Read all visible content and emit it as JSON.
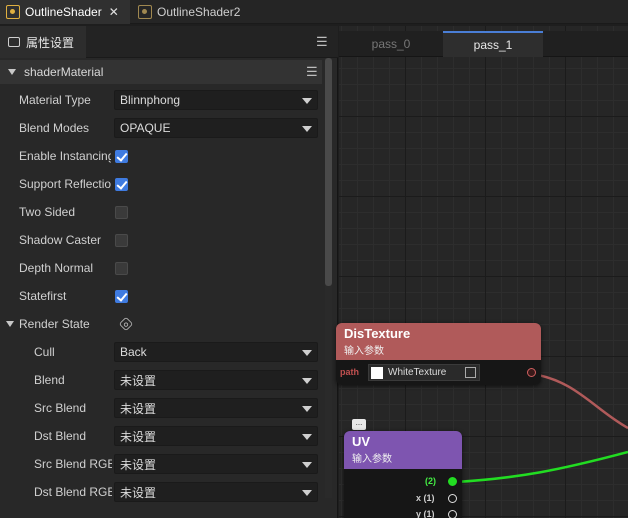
{
  "file_tabs": [
    {
      "label": "OutlineShader",
      "close": "✕"
    },
    {
      "label": "OutlineShader2"
    }
  ],
  "panel": {
    "tab_label": "属性设置",
    "menu_glyph": "☰",
    "section_title": "shaderMaterial",
    "rows": {
      "material_type": {
        "label": "Material Type",
        "value": "Blinnphong"
      },
      "blend_modes": {
        "label": "Blend Modes",
        "value": "OPAQUE"
      },
      "enable_instancing": {
        "label": "Enable Instancing",
        "checked": true
      },
      "support_reflection": {
        "label": "Support Reflection",
        "checked": true
      },
      "two_sided": {
        "label": "Two Sided",
        "checked": false
      },
      "shadow_caster": {
        "label": "Shadow Caster",
        "checked": false
      },
      "depth_normal": {
        "label": "Depth Normal",
        "checked": false
      },
      "statefirst": {
        "label": "Statefirst",
        "checked": true
      }
    },
    "render_state": {
      "label": "Render State",
      "cull": {
        "label": "Cull",
        "value": "Back"
      },
      "blend": {
        "label": "Blend",
        "value": "未设置"
      },
      "src_blend": {
        "label": "Src Blend",
        "value": "未设置"
      },
      "dst_blend": {
        "label": "Dst Blend",
        "value": "未设置"
      },
      "src_blend_rgb": {
        "label": "Src Blend RGB",
        "value": "未设置"
      },
      "dst_blend_rgb": {
        "label": "Dst Blend RGB",
        "value": "未设置"
      }
    }
  },
  "graph": {
    "passes": [
      "pass_0",
      "pass_1"
    ],
    "active_pass": "pass_1",
    "nodes": {
      "distexture": {
        "title": "DisTexture",
        "subtitle": "输入参数",
        "port_label": "path",
        "texture_value": "WhiteTexture",
        "color": "#b05a5a"
      },
      "uv": {
        "title": "UV",
        "subtitle": "输入参数",
        "out_main": "(2)",
        "out_x": "x (1)",
        "out_y": "y (1)",
        "color": "#7e55b0"
      }
    },
    "comment_glyph": "..."
  },
  "colors": {
    "accent": "#3f7be0",
    "wire_green": "#22dd22",
    "wire_red": "#b05a5a"
  }
}
